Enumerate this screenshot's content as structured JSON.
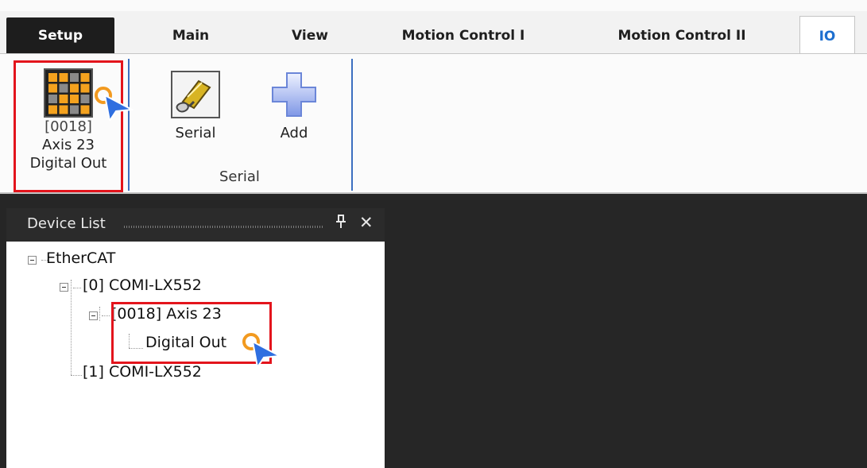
{
  "tabs": [
    {
      "label": "Setup"
    },
    {
      "label": "Main"
    },
    {
      "label": "View"
    },
    {
      "label": "Motion Control I"
    },
    {
      "label": "Motion Control II"
    },
    {
      "label": "IO"
    }
  ],
  "ribbon": {
    "digital_out": {
      "line1": "[0018]",
      "line2": "Axis 23",
      "line3": "Digital Out"
    },
    "serial_button": "Serial",
    "add_button": "Add",
    "serial_group_label": "Serial"
  },
  "device_list": {
    "title": "Device List",
    "pin_glyph": "1",
    "close_glyph": "✕",
    "tree": {
      "root": "EtherCAT",
      "device0": "[0] COMI-LX552",
      "axis": "[0018] Axis 23",
      "digital_out": "Digital Out",
      "device1": "[1] COMI-LX552"
    }
  },
  "colors": {
    "accent_blue": "#1e6fcf",
    "highlight_red": "#e3141c",
    "cursor_blue": "#2f6fe0",
    "cursor_ring": "#f29a1f"
  }
}
